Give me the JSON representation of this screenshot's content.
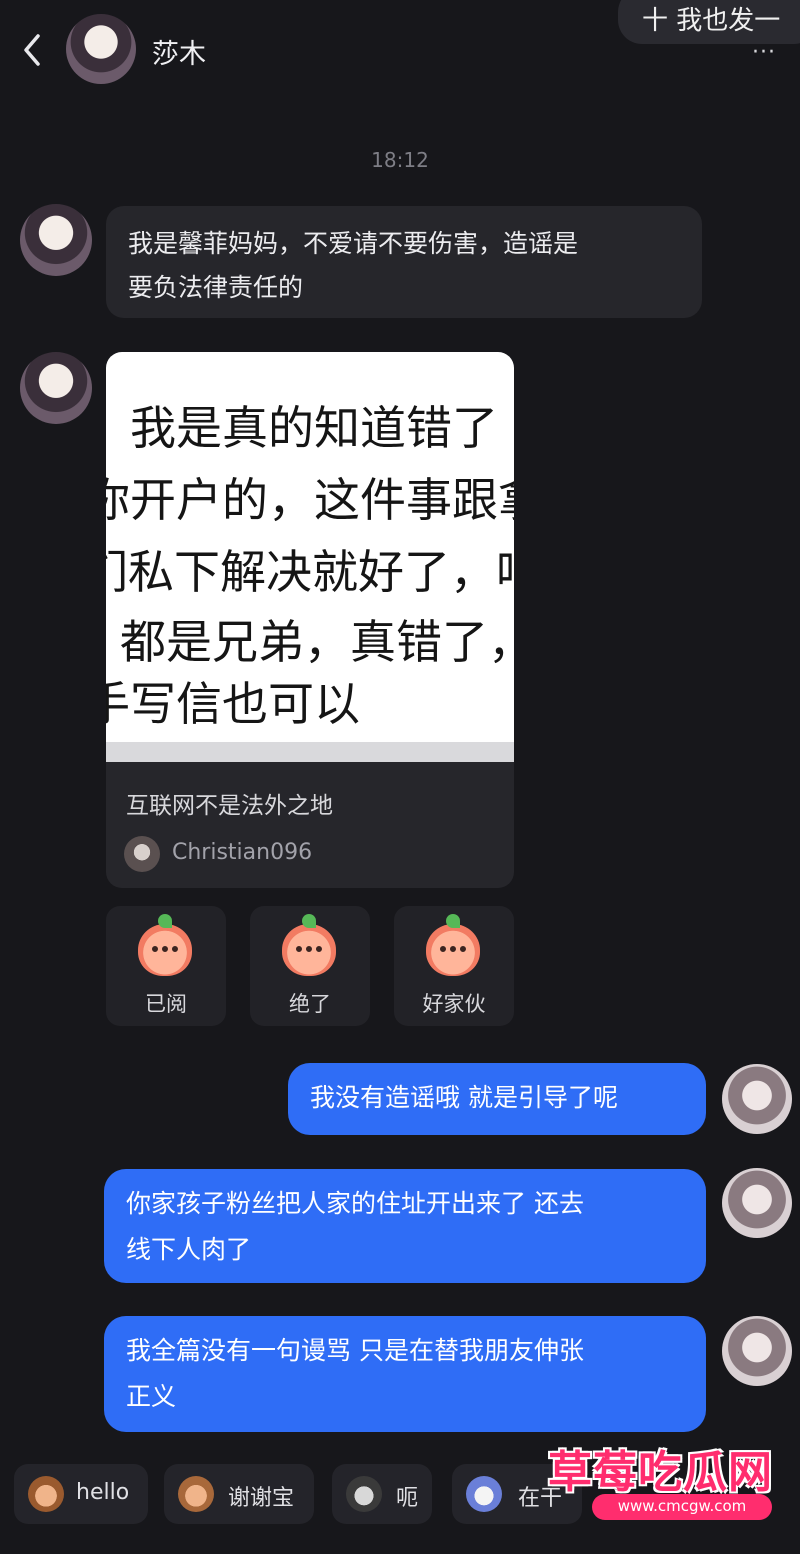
{
  "header": {
    "back_icon": "chevron-left-icon",
    "contact_name": "莎木",
    "top_pill_text": "十 我也发一",
    "more_icon": "···"
  },
  "timestamp": "18:12",
  "messages": {
    "incoming_text_line1": "我是馨菲妈妈，不爱请不要伤害，造谣是",
    "incoming_text_line2": "要负法律责任的",
    "card": {
      "image_lines": [
        "我是真的知道错了",
        "你开户的，这件事跟拿",
        "们私下解决就好了，咱",
        "都是兄弟，真错了，",
        "手写信也可以"
      ],
      "title": "互联网不是法外之地",
      "author": "Christian096"
    },
    "reactions": [
      {
        "label": "已阅",
        "icon": "peach-sticker-icon"
      },
      {
        "label": "绝了",
        "icon": "peach-shock-sticker-icon"
      },
      {
        "label": "好家伙",
        "icon": "peach-wow-sticker-icon"
      }
    ],
    "outgoing": [
      {
        "line1": "我没有造谣哦 就是引导了呢",
        "line2": ""
      },
      {
        "line1": "你家孩子粉丝把人家的住址开出来了 还去",
        "line2": "线下人肉了"
      },
      {
        "line1": "我全篇没有一句谩骂 只是在替我朋友伸张",
        "line2": "正义"
      }
    ]
  },
  "quick_replies": [
    {
      "label": "hello",
      "icon": "monkey-sticker-icon"
    },
    {
      "label": "谢谢宝",
      "icon": "monkey-thanks-sticker-icon"
    },
    {
      "label": "呃",
      "icon": "cat-sticker-icon"
    },
    {
      "label": "在干",
      "icon": "sticker-icon"
    }
  ],
  "watermark": {
    "title": "草莓吃瓜网",
    "url": "www.cmcgw.com"
  },
  "colors": {
    "background": "#17171b",
    "incoming_bubble": "#26262b",
    "outgoing_bubble": "#2f6df6",
    "watermark": "#ff2d6e"
  }
}
